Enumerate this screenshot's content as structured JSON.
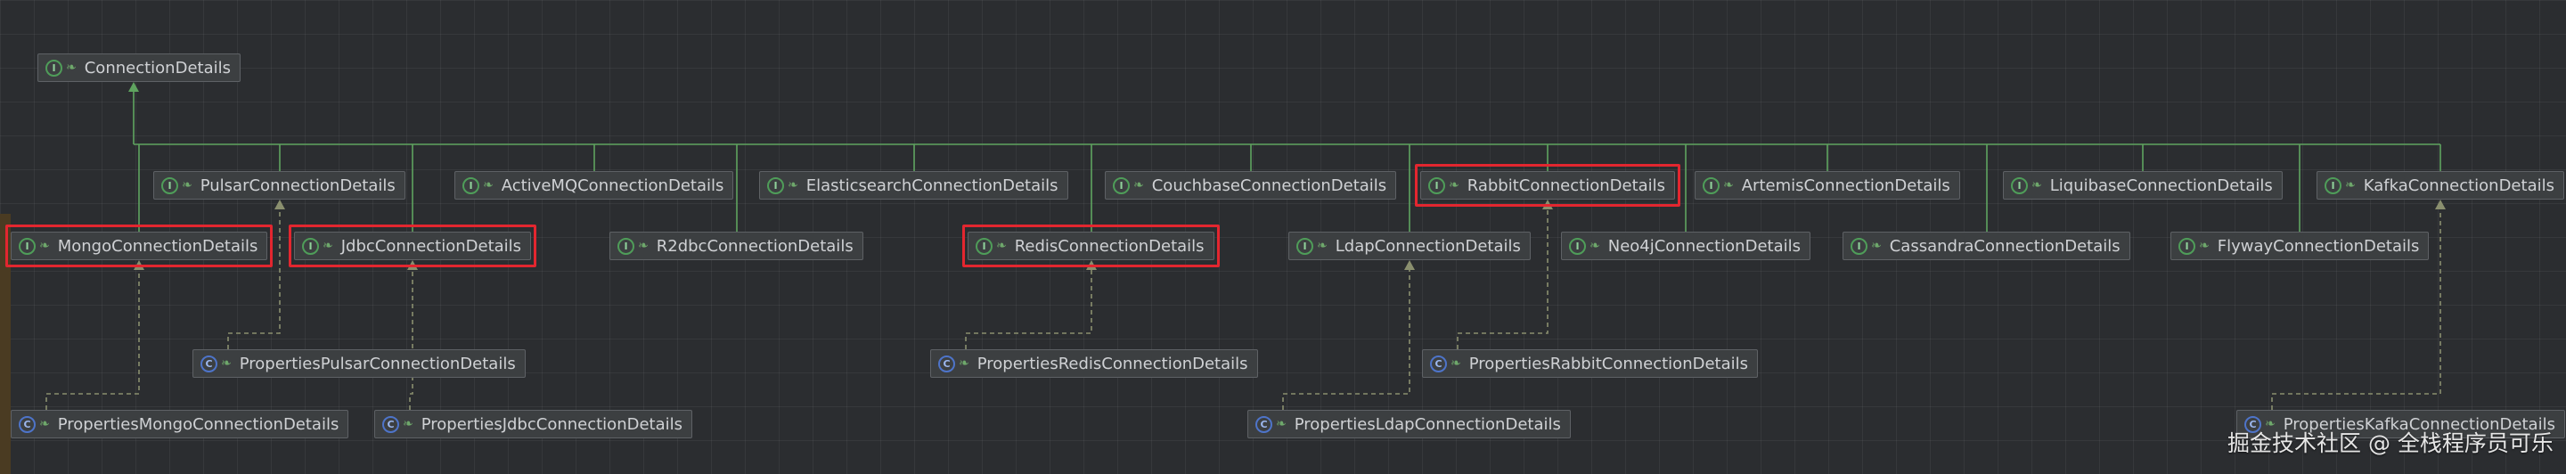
{
  "nodes": [
    {
      "id": "root",
      "kind": "interface",
      "label": "ConnectionDetails"
    },
    {
      "id": "pulsar",
      "kind": "interface",
      "label": "PulsarConnectionDetails"
    },
    {
      "id": "activemq",
      "kind": "interface",
      "label": "ActiveMQConnectionDetails"
    },
    {
      "id": "elasticsearch",
      "kind": "interface",
      "label": "ElasticsearchConnectionDetails"
    },
    {
      "id": "couchbase",
      "kind": "interface",
      "label": "CouchbaseConnectionDetails"
    },
    {
      "id": "rabbit",
      "kind": "interface",
      "label": "RabbitConnectionDetails"
    },
    {
      "id": "artemis",
      "kind": "interface",
      "label": "ArtemisConnectionDetails"
    },
    {
      "id": "liquibase",
      "kind": "interface",
      "label": "LiquibaseConnectionDetails"
    },
    {
      "id": "kafka",
      "kind": "interface",
      "label": "KafkaConnectionDetails"
    },
    {
      "id": "mongo",
      "kind": "interface",
      "label": "MongoConnectionDetails"
    },
    {
      "id": "jdbc",
      "kind": "interface",
      "label": "JdbcConnectionDetails"
    },
    {
      "id": "r2dbc",
      "kind": "interface",
      "label": "R2dbcConnectionDetails"
    },
    {
      "id": "redis",
      "kind": "interface",
      "label": "RedisConnectionDetails"
    },
    {
      "id": "ldap",
      "kind": "interface",
      "label": "LdapConnectionDetails"
    },
    {
      "id": "neo4j",
      "kind": "interface",
      "label": "Neo4jConnectionDetails"
    },
    {
      "id": "cassandra",
      "kind": "interface",
      "label": "CassandraConnectionDetails"
    },
    {
      "id": "flyway",
      "kind": "interface",
      "label": "FlywayConnectionDetails"
    },
    {
      "id": "p_pulsar",
      "kind": "class",
      "label": "PropertiesPulsarConnectionDetails"
    },
    {
      "id": "p_redis",
      "kind": "class",
      "label": "PropertiesRedisConnectionDetails"
    },
    {
      "id": "p_rabbit",
      "kind": "class",
      "label": "PropertiesRabbitConnectionDetails"
    },
    {
      "id": "p_mongo",
      "kind": "class",
      "label": "PropertiesMongoConnectionDetails"
    },
    {
      "id": "p_jdbc",
      "kind": "class",
      "label": "PropertiesJdbcConnectionDetails"
    },
    {
      "id": "p_ldap",
      "kind": "class",
      "label": "PropertiesLdapConnectionDetails"
    },
    {
      "id": "p_kafka",
      "kind": "class",
      "label": "PropertiesKafkaConnectionDetails"
    }
  ],
  "edges": [
    {
      "from": "pulsar",
      "to": "root",
      "type": "extends"
    },
    {
      "from": "activemq",
      "to": "root",
      "type": "extends"
    },
    {
      "from": "elasticsearch",
      "to": "root",
      "type": "extends"
    },
    {
      "from": "couchbase",
      "to": "root",
      "type": "extends"
    },
    {
      "from": "rabbit",
      "to": "root",
      "type": "extends"
    },
    {
      "from": "artemis",
      "to": "root",
      "type": "extends"
    },
    {
      "from": "liquibase",
      "to": "root",
      "type": "extends"
    },
    {
      "from": "kafka",
      "to": "root",
      "type": "extends"
    },
    {
      "from": "mongo",
      "to": "root",
      "type": "extends"
    },
    {
      "from": "jdbc",
      "to": "root",
      "type": "extends"
    },
    {
      "from": "r2dbc",
      "to": "root",
      "type": "extends"
    },
    {
      "from": "redis",
      "to": "root",
      "type": "extends"
    },
    {
      "from": "ldap",
      "to": "root",
      "type": "extends"
    },
    {
      "from": "neo4j",
      "to": "root",
      "type": "extends"
    },
    {
      "from": "cassandra",
      "to": "root",
      "type": "extends"
    },
    {
      "from": "flyway",
      "to": "root",
      "type": "extends"
    },
    {
      "from": "p_pulsar",
      "to": "pulsar",
      "type": "implements"
    },
    {
      "from": "p_redis",
      "to": "redis",
      "type": "implements"
    },
    {
      "from": "p_rabbit",
      "to": "rabbit",
      "type": "implements"
    },
    {
      "from": "p_mongo",
      "to": "mongo",
      "type": "implements"
    },
    {
      "from": "p_jdbc",
      "to": "jdbc",
      "type": "implements"
    },
    {
      "from": "p_ldap",
      "to": "ldap",
      "type": "implements"
    },
    {
      "from": "p_kafka",
      "to": "kafka",
      "type": "implements"
    }
  ],
  "highlighted": [
    "mongo",
    "jdbc",
    "redis",
    "rabbit"
  ],
  "icons": {
    "interface": "interface-icon",
    "class": "class-icon",
    "leaf": "leaf-icon"
  },
  "colors": {
    "background": "#2b2d30",
    "node_fill": "#3c3f41",
    "node_border": "#5e6165",
    "extends_line": "#5fa35f",
    "implements_line": "#8a8f6e",
    "highlight": "#e3262f",
    "interface_icon": "#4f9d59",
    "class_icon": "#4e74c9"
  },
  "watermark": "掘金技术社区 @ 全栈程序员可乐"
}
